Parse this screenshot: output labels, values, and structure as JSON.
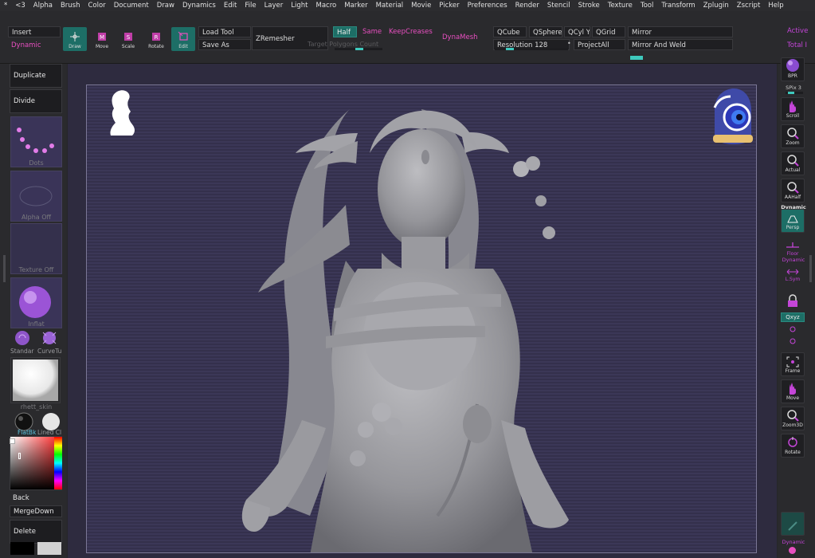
{
  "menu": [
    "*",
    "<3",
    "Alpha",
    "Brush",
    "Color",
    "Document",
    "Draw",
    "Dynamics",
    "Edit",
    "File",
    "Layer",
    "Light",
    "Macro",
    "Marker",
    "Material",
    "Movie",
    "Picker",
    "Preferences",
    "Render",
    "Stencil",
    "Stroke",
    "Texture",
    "Tool",
    "Transform",
    "Zplugin",
    "Zscript",
    "Help"
  ],
  "topshelf": {
    "insert": "Insert",
    "dynamic": "Dynamic",
    "tools": {
      "draw": "Draw",
      "move": "Move",
      "scale": "Scale",
      "rotate": "Rotate",
      "edit": "Edit"
    },
    "load_tool": "Load Tool",
    "save_as": "Save As",
    "zremesher": "ZRemesher",
    "target_polygons": "Target Polygons Count",
    "half": "Half",
    "same": "Same",
    "keepcreases": "KeepCreases",
    "dynamesh": "DynaMesh",
    "qcube": "QCube",
    "qsphere": "QSphere",
    "qcyly": "QCyl Y",
    "qgrid": "QGrid",
    "resolution": "Resolution 128",
    "projectall": "ProjectAll",
    "mirror": "Mirror",
    "mirror_weld": "Mirror And Weld",
    "active": "Active",
    "total": "Total I"
  },
  "left": {
    "duplicate": "Duplicate",
    "divide": "Divide",
    "dots": "Dots",
    "alpha_off": "Alpha Off",
    "texture_off": "Texture Off",
    "inflat": "Inflat",
    "standard": "Standar",
    "curvetube": "CurveTu",
    "material": "rhett_skin",
    "matcap1": "FlatBk",
    "matcap2": "Lined Cl",
    "back": "Back",
    "mergedown": "MergeDown",
    "delete": "Delete"
  },
  "right": {
    "bpr": "BPR",
    "spix": "SPix 3",
    "scroll": "Scroll",
    "zoom": "Zoom",
    "actual": "Actual",
    "aahalf": "AAHalf",
    "dynamic": "Dynamic",
    "persp": "Persp",
    "floor": "Floor",
    "dynamic2": "Dynamic",
    "lsym": "L.Sym",
    "xyz": "Qxyz",
    "frame": "Frame",
    "move": "Move",
    "zoom3d": "Zoom3D",
    "rotate": "Rotate",
    "dynamic3": "Dynamic"
  },
  "colors": {
    "accent": "#1d6e66",
    "pink": "#e84fc0",
    "magenta": "#c445d8"
  }
}
